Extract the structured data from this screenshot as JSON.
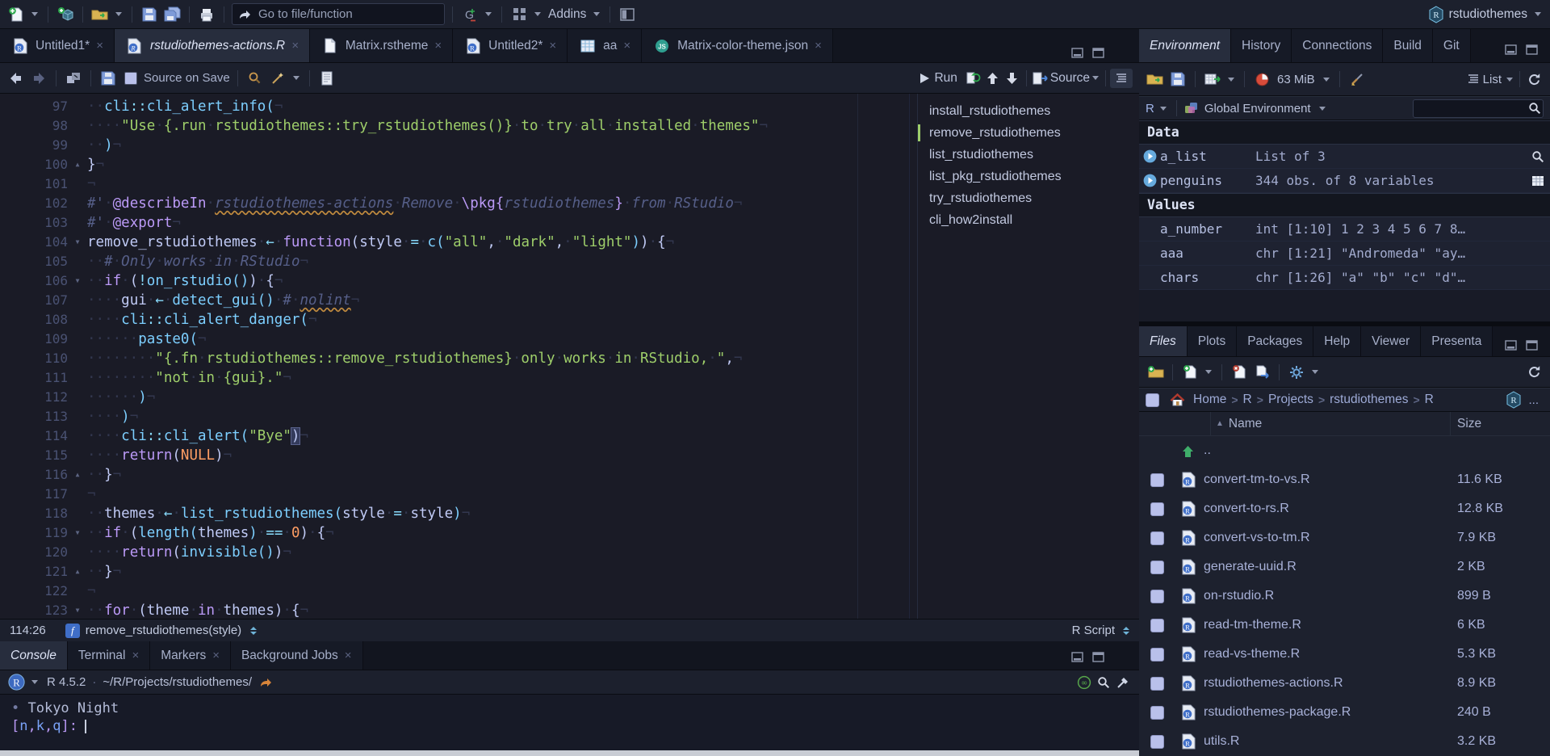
{
  "toolbar": {
    "goto_placeholder": "Go to file/function",
    "addins_label": "Addins",
    "project_name": "rstudiothemes"
  },
  "editor": {
    "tabs": [
      {
        "label": "Untitled1*",
        "icon": "r",
        "active": false
      },
      {
        "label": "rstudiothemes-actions.R",
        "icon": "r",
        "active": true
      },
      {
        "label": "Matrix.rstheme",
        "icon": "doc",
        "active": false
      },
      {
        "label": "Untitled2*",
        "icon": "r",
        "active": false
      },
      {
        "label": "aa",
        "icon": "grid",
        "active": false
      },
      {
        "label": "Matrix-color-theme.json",
        "icon": "js",
        "active": false
      }
    ],
    "toolbar": {
      "source_on_save": "Source on Save",
      "run_label": "Run",
      "source_label": "Source"
    },
    "lines": [
      {
        "n": 97,
        "fold": "",
        "segs": [
          [
            "  ",
            "f"
          ],
          [
            "cli",
            "n"
          ],
          [
            "::",
            "o"
          ],
          [
            "cli_alert_info",
            "n"
          ],
          [
            "(",
            "n"
          ]
        ]
      },
      {
        "n": 98,
        "fold": "",
        "segs": [
          [
            "    ",
            "f"
          ],
          [
            "\"Use {.run rstudiothemes::try_rstudiothemes()} to try all installed themes\"",
            "s"
          ]
        ]
      },
      {
        "n": 99,
        "fold": "",
        "segs": [
          [
            "  ",
            "f"
          ],
          [
            ")",
            "n"
          ]
        ]
      },
      {
        "n": 100,
        "fold": "u",
        "segs": [
          [
            "}",
            "f"
          ]
        ]
      },
      {
        "n": 101,
        "fold": "",
        "segs": []
      },
      {
        "n": 102,
        "fold": "",
        "segs": [
          [
            "#' ",
            "c"
          ],
          [
            "@describeIn",
            "k"
          ],
          [
            " ",
            "c"
          ],
          [
            "rstudiothemes-actions",
            "u"
          ],
          [
            " Remove ",
            "c"
          ],
          [
            "\\pkg{",
            "k"
          ],
          [
            "rstudiothemes",
            "c"
          ],
          [
            "}",
            "k"
          ],
          [
            " from RStudio",
            "c"
          ]
        ]
      },
      {
        "n": 103,
        "fold": "",
        "segs": [
          [
            "#' ",
            "c"
          ],
          [
            "@export",
            "k"
          ]
        ]
      },
      {
        "n": 104,
        "fold": "d",
        "segs": [
          [
            "remove_rstudiothemes",
            "f"
          ],
          [
            " ",
            "f"
          ],
          [
            "←",
            "o"
          ],
          [
            " ",
            "f"
          ],
          [
            "function",
            "k"
          ],
          [
            "(",
            "f"
          ],
          [
            "style",
            "f"
          ],
          [
            " ",
            "f"
          ],
          [
            "=",
            "o"
          ],
          [
            " ",
            "f"
          ],
          [
            "c",
            "n"
          ],
          [
            "(",
            "n"
          ],
          [
            "\"all\"",
            "s"
          ],
          [
            ", ",
            "f"
          ],
          [
            "\"dark\"",
            "s"
          ],
          [
            ", ",
            "f"
          ],
          [
            "\"light\"",
            "s"
          ],
          [
            ")",
            "n"
          ],
          [
            ")",
            "f"
          ],
          [
            " {",
            "f"
          ]
        ]
      },
      {
        "n": 105,
        "fold": "",
        "segs": [
          [
            "  # Only works in RStudio",
            "c"
          ]
        ]
      },
      {
        "n": 106,
        "fold": "d",
        "segs": [
          [
            "  ",
            "f"
          ],
          [
            "if",
            "k"
          ],
          [
            " (",
            "f"
          ],
          [
            "!",
            "o"
          ],
          [
            "on_rstudio",
            "n"
          ],
          [
            "()",
            "n"
          ],
          [
            ") {",
            "f"
          ]
        ]
      },
      {
        "n": 107,
        "fold": "",
        "segs": [
          [
            "    ",
            "f"
          ],
          [
            "gui",
            "f"
          ],
          [
            " ",
            "f"
          ],
          [
            "←",
            "o"
          ],
          [
            " ",
            "f"
          ],
          [
            "detect_gui",
            "n"
          ],
          [
            "()",
            "n"
          ],
          [
            " ",
            "f"
          ],
          [
            "# ",
            "c"
          ],
          [
            "nolint",
            "u"
          ]
        ]
      },
      {
        "n": 108,
        "fold": "",
        "segs": [
          [
            "    ",
            "f"
          ],
          [
            "cli",
            "n"
          ],
          [
            "::",
            "o"
          ],
          [
            "cli_alert_danger",
            "n"
          ],
          [
            "(",
            "n"
          ]
        ]
      },
      {
        "n": 109,
        "fold": "",
        "segs": [
          [
            "      ",
            "f"
          ],
          [
            "paste0",
            "n"
          ],
          [
            "(",
            "n"
          ]
        ]
      },
      {
        "n": 110,
        "fold": "",
        "segs": [
          [
            "        ",
            "f"
          ],
          [
            "\"{.fn rstudiothemes::remove_rstudiothemes} only works in RStudio, \"",
            "s"
          ],
          [
            ",",
            "f"
          ]
        ]
      },
      {
        "n": 111,
        "fold": "",
        "segs": [
          [
            "        ",
            "f"
          ],
          [
            "\"not in {gui}.\"",
            "s"
          ]
        ]
      },
      {
        "n": 112,
        "fold": "",
        "segs": [
          [
            "      ",
            "f"
          ],
          [
            ")",
            "n"
          ]
        ]
      },
      {
        "n": 113,
        "fold": "",
        "segs": [
          [
            "    ",
            "f"
          ],
          [
            ")",
            "n"
          ]
        ]
      },
      {
        "n": 114,
        "fold": "",
        "segs": [
          [
            "    ",
            "f"
          ],
          [
            "cli",
            "n"
          ],
          [
            "::",
            "o"
          ],
          [
            "cli_alert",
            "n"
          ],
          [
            "(",
            "n"
          ],
          [
            "\"Bye\"",
            "s"
          ],
          [
            ")",
            "p"
          ]
        ]
      },
      {
        "n": 115,
        "fold": "",
        "segs": [
          [
            "    ",
            "f"
          ],
          [
            "return",
            "k"
          ],
          [
            "(",
            "f"
          ],
          [
            "NULL",
            "d"
          ],
          [
            ")",
            "f"
          ]
        ]
      },
      {
        "n": 116,
        "fold": "u",
        "segs": [
          [
            "  }",
            "f"
          ]
        ]
      },
      {
        "n": 117,
        "fold": "",
        "segs": []
      },
      {
        "n": 118,
        "fold": "",
        "segs": [
          [
            "  ",
            "f"
          ],
          [
            "themes",
            "f"
          ],
          [
            " ",
            "f"
          ],
          [
            "←",
            "o"
          ],
          [
            " ",
            "f"
          ],
          [
            "list_rstudiothemes",
            "n"
          ],
          [
            "(",
            "n"
          ],
          [
            "style",
            "f"
          ],
          [
            " ",
            "f"
          ],
          [
            "=",
            "o"
          ],
          [
            " ",
            "f"
          ],
          [
            "style",
            "f"
          ],
          [
            ")",
            "n"
          ]
        ]
      },
      {
        "n": 119,
        "fold": "d",
        "segs": [
          [
            "  ",
            "f"
          ],
          [
            "if",
            "k"
          ],
          [
            " (",
            "f"
          ],
          [
            "length",
            "n"
          ],
          [
            "(",
            "n"
          ],
          [
            "themes",
            "f"
          ],
          [
            ")",
            "n"
          ],
          [
            " ",
            "f"
          ],
          [
            "==",
            "o"
          ],
          [
            " ",
            "f"
          ],
          [
            "0",
            "d"
          ],
          [
            ") {",
            "f"
          ]
        ]
      },
      {
        "n": 120,
        "fold": "",
        "segs": [
          [
            "    ",
            "f"
          ],
          [
            "return",
            "k"
          ],
          [
            "(",
            "f"
          ],
          [
            "invisible",
            "n"
          ],
          [
            "()",
            "n"
          ],
          [
            ")",
            "f"
          ]
        ]
      },
      {
        "n": 121,
        "fold": "u",
        "segs": [
          [
            "  }",
            "f"
          ]
        ]
      },
      {
        "n": 122,
        "fold": "",
        "segs": []
      },
      {
        "n": 123,
        "fold": "d",
        "segs": [
          [
            "  ",
            "f"
          ],
          [
            "for",
            "k"
          ],
          [
            " (",
            "f"
          ],
          [
            "theme",
            "f"
          ],
          [
            " ",
            "f"
          ],
          [
            "in",
            "k"
          ],
          [
            " ",
            "f"
          ],
          [
            "themes",
            "f"
          ],
          [
            ") {",
            "f"
          ]
        ]
      }
    ],
    "outline": {
      "items": [
        "install_rstudiothemes",
        "remove_rstudiothemes",
        "list_rstudiothemes",
        "list_pkg_rstudiothemes",
        "try_rstudiothemes",
        "cli_how2install"
      ],
      "current": "remove_rstudiothemes"
    },
    "status": {
      "cursor": "114:26",
      "scope": "remove_rstudiothemes(style)",
      "filetype": "R Script"
    }
  },
  "environment": {
    "tabs": [
      "Environment",
      "History",
      "Connections",
      "Build",
      "Git"
    ],
    "active_tab": "Environment",
    "toolbar": {
      "memory": "63 MiB",
      "list_label": "List"
    },
    "toolbar2": {
      "language": "R",
      "scope": "Global Environment"
    },
    "sections": [
      {
        "title": "Data",
        "rows": [
          {
            "name": "a_list",
            "value": "List of 3",
            "expander": true,
            "action": "mag"
          },
          {
            "name": "penguins",
            "value": "344 obs. of 8 variables",
            "expander": true,
            "action": "tbl"
          }
        ]
      },
      {
        "title": "Values",
        "rows": [
          {
            "name": "a_number",
            "value": "int [1:10] 1 2 3 4 5 6 7 8…"
          },
          {
            "name": "aaa",
            "value": "chr [1:21] \"Andromeda\" \"ay…"
          },
          {
            "name": "chars",
            "value": "chr [1:26] \"a\" \"b\" \"c\" \"d\"…"
          }
        ]
      }
    ]
  },
  "files": {
    "tabs": [
      "Files",
      "Plots",
      "Packages",
      "Help",
      "Viewer",
      "Presenta"
    ],
    "active_tab": "Files",
    "breadcrumb": [
      "Home",
      "R",
      "Projects",
      "rstudiothemes",
      "R"
    ],
    "more_label": "...",
    "columns": {
      "name": "Name",
      "size": "Size"
    },
    "rows": [
      {
        "name": "..",
        "size": "",
        "icon": "up"
      },
      {
        "name": "convert-tm-to-vs.R",
        "size": "11.6 KB",
        "icon": "r"
      },
      {
        "name": "convert-to-rs.R",
        "size": "12.8 KB",
        "icon": "r"
      },
      {
        "name": "convert-vs-to-tm.R",
        "size": "7.9 KB",
        "icon": "r"
      },
      {
        "name": "generate-uuid.R",
        "size": "2 KB",
        "icon": "r"
      },
      {
        "name": "on-rstudio.R",
        "size": "899 B",
        "icon": "r"
      },
      {
        "name": "read-tm-theme.R",
        "size": "6 KB",
        "icon": "r"
      },
      {
        "name": "read-vs-theme.R",
        "size": "5.3 KB",
        "icon": "r"
      },
      {
        "name": "rstudiothemes-actions.R",
        "size": "8.9 KB",
        "icon": "r"
      },
      {
        "name": "rstudiothemes-package.R",
        "size": "240 B",
        "icon": "r"
      },
      {
        "name": "utils.R",
        "size": "3.2 KB",
        "icon": "r"
      }
    ]
  },
  "console": {
    "tabs": [
      "Console",
      "Terminal",
      "Markers",
      "Background Jobs"
    ],
    "active_tab": "Console",
    "header": {
      "version": "R 4.5.2",
      "separator": "·",
      "path": "~/R/Projects/rstudiothemes/"
    },
    "output": [
      {
        "bullet": "•",
        "text": "Tokyo Night"
      }
    ],
    "prompt": "[n,k,q]:"
  },
  "colors": {
    "editor_bg": "#1a1b26",
    "chrome_bg": "#1c202d",
    "strip_bg": "#12151f",
    "active_tab_bg": "#272d3d",
    "foreground": "#c0caf5",
    "string_green": "#9ece6a",
    "keyword_purple": "#bb9af7",
    "function_cyan": "#7dcfff",
    "operator_blue": "#89ddff",
    "number_orange": "#ff9e64",
    "comment_gray": "#565f89",
    "outline_marker_green": "#9ece6a"
  },
  "icons": {
    "new-file-icon": "page-plus",
    "new-project-icon": "cube-plus",
    "open-file-icon": "folder-arrow",
    "save-icon": "floppy",
    "save-all-icon": "floppy-stack",
    "print-icon": "printer",
    "goto-arrow-icon": "curved-arrow",
    "version-control-icon": "G-plus-minus",
    "addins-icon": "grid-4",
    "panes-layout-icon": "split-rect",
    "project-icon": "R-hexagon",
    "back-icon": "arrow-left",
    "forward-icon": "arrow-right",
    "popout-icon": "window-arrow",
    "find-icon": "magnifier",
    "code-tools-icon": "magic-wand",
    "compile-report-icon": "notebook",
    "run-icon": "play-arrow",
    "rerun-icon": "green-redo",
    "go-up-icon": "arrow-up",
    "go-down-icon": "arrow-down",
    "source-menu-icon": "page-blue-arrow",
    "outline-toggle-icon": "list-lines",
    "minimize-pane-icon": "window-min",
    "maximize-pane-icon": "window-max",
    "r-logo-icon": "R-sphere",
    "working-dir-icon": "orange-curved-arrow",
    "session-suspend-icon": "green-infinity",
    "search-console-icon": "magnifier",
    "clear-console-icon": "squeegee",
    "load-workspace-icon": "folder-arrow",
    "save-workspace-icon": "floppy",
    "import-dataset-icon": "table-green-arrow",
    "memory-usage-icon": "red-pie",
    "clear-objects-icon": "broom",
    "refresh-icon": "circular-arrow",
    "environment-scope-icon": "color-squares",
    "search-icon": "magnifier",
    "new-folder-icon": "folder-plus",
    "new-blank-file-icon": "page-plus",
    "delete-file-icon": "page-red-x",
    "copy-file-icon": "page-blue-arrow",
    "more-options-icon": "gear",
    "home-icon": "house",
    "up-directory-icon": "green-up-arrow",
    "r-doc-icon": "page-R-badge",
    "spreadsheet-icon": "grid-page",
    "json-icon": "JS-circle",
    "expander-icon": "blue-play-circle",
    "inspect-icon": "magnifier",
    "view-table-icon": "grid"
  }
}
